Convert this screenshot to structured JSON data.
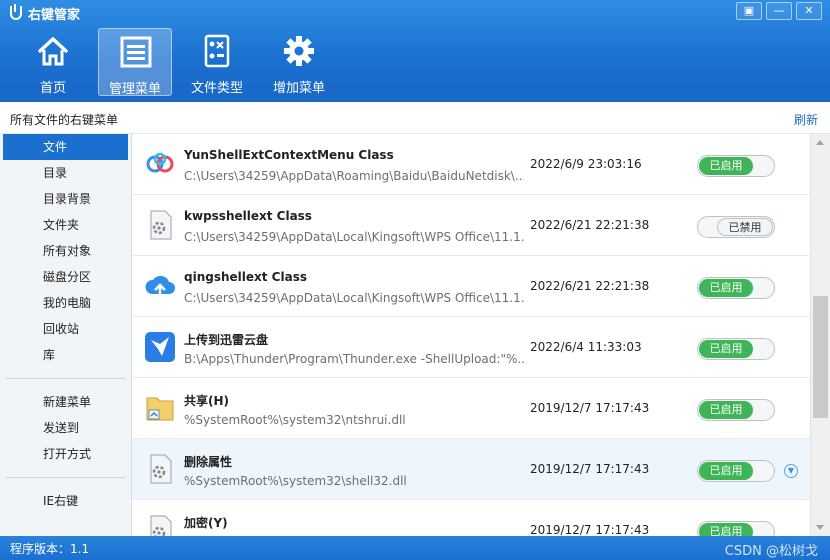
{
  "window": {
    "title": "右键管家",
    "controls": {
      "settings": "▣",
      "minimize": "—",
      "close": "✕"
    }
  },
  "nav": [
    {
      "label": "首页",
      "icon": "home-icon"
    },
    {
      "label": "管理菜单",
      "icon": "menu-list-icon",
      "active": true
    },
    {
      "label": "文件类型",
      "icon": "file-type-icon"
    },
    {
      "label": "增加菜单",
      "icon": "gear-icon"
    }
  ],
  "subheader": {
    "title": "所有文件的右键菜单",
    "refresh": "刷新"
  },
  "sidebar": {
    "group1": [
      "文件",
      "目录",
      "目录背景",
      "文件夹",
      "所有对象",
      "磁盘分区",
      "我的电脑",
      "回收站",
      "库"
    ],
    "group2": [
      "新建菜单",
      "发送到",
      "打开方式"
    ],
    "group3": [
      "IE右键"
    ]
  },
  "rows": [
    {
      "name": "YunShellExtContextMenu Class",
      "path": "C:\\Users\\34259\\AppData\\Roaming\\Baidu\\BaiduNetdisk\\...",
      "date": "2022/6/9 23:03:16",
      "status": "已启用",
      "enabled": true,
      "icon": "baidu-netdisk-icon"
    },
    {
      "name": "kwpsshellext Class",
      "path": "C:\\Users\\34259\\AppData\\Local\\Kingsoft\\WPS Office\\11.1...",
      "date": "2022/6/21 22:21:38",
      "status": "已禁用",
      "enabled": false,
      "icon": "gear-file-icon"
    },
    {
      "name": "qingshellext Class",
      "path": "C:\\Users\\34259\\AppData\\Local\\Kingsoft\\WPS Office\\11.1...",
      "date": "2022/6/21 22:21:38",
      "status": "已启用",
      "enabled": true,
      "icon": "cloud-upload-icon"
    },
    {
      "name": "上传到迅雷云盘",
      "path": "B:\\Apps\\Thunder\\Program\\Thunder.exe -ShellUpload:\"%...",
      "date": "2022/6/4 11:33:03",
      "status": "已启用",
      "enabled": true,
      "icon": "thunder-icon"
    },
    {
      "name": "共享(H)",
      "path": "%SystemRoot%\\system32\\ntshrui.dll",
      "date": "2019/12/7 17:17:43",
      "status": "已启用",
      "enabled": true,
      "icon": "share-folder-icon"
    },
    {
      "name": "删除属性",
      "path": "%SystemRoot%\\system32\\shell32.dll",
      "date": "2019/12/7 17:17:43",
      "status": "已启用",
      "enabled": true,
      "icon": "gear-file-icon",
      "highlight": true,
      "expand": "▼"
    },
    {
      "name": "加密(Y)",
      "path": "",
      "date": "2019/12/7 17:17:43",
      "status": "已启用",
      "enabled": true,
      "icon": "gear-file-icon"
    }
  ],
  "status": {
    "version": "程序版本：1.1",
    "watermark": "CSDN @松树戈"
  },
  "colors": {
    "accent": "#1a6fcf",
    "enabled": "#3fb558"
  }
}
